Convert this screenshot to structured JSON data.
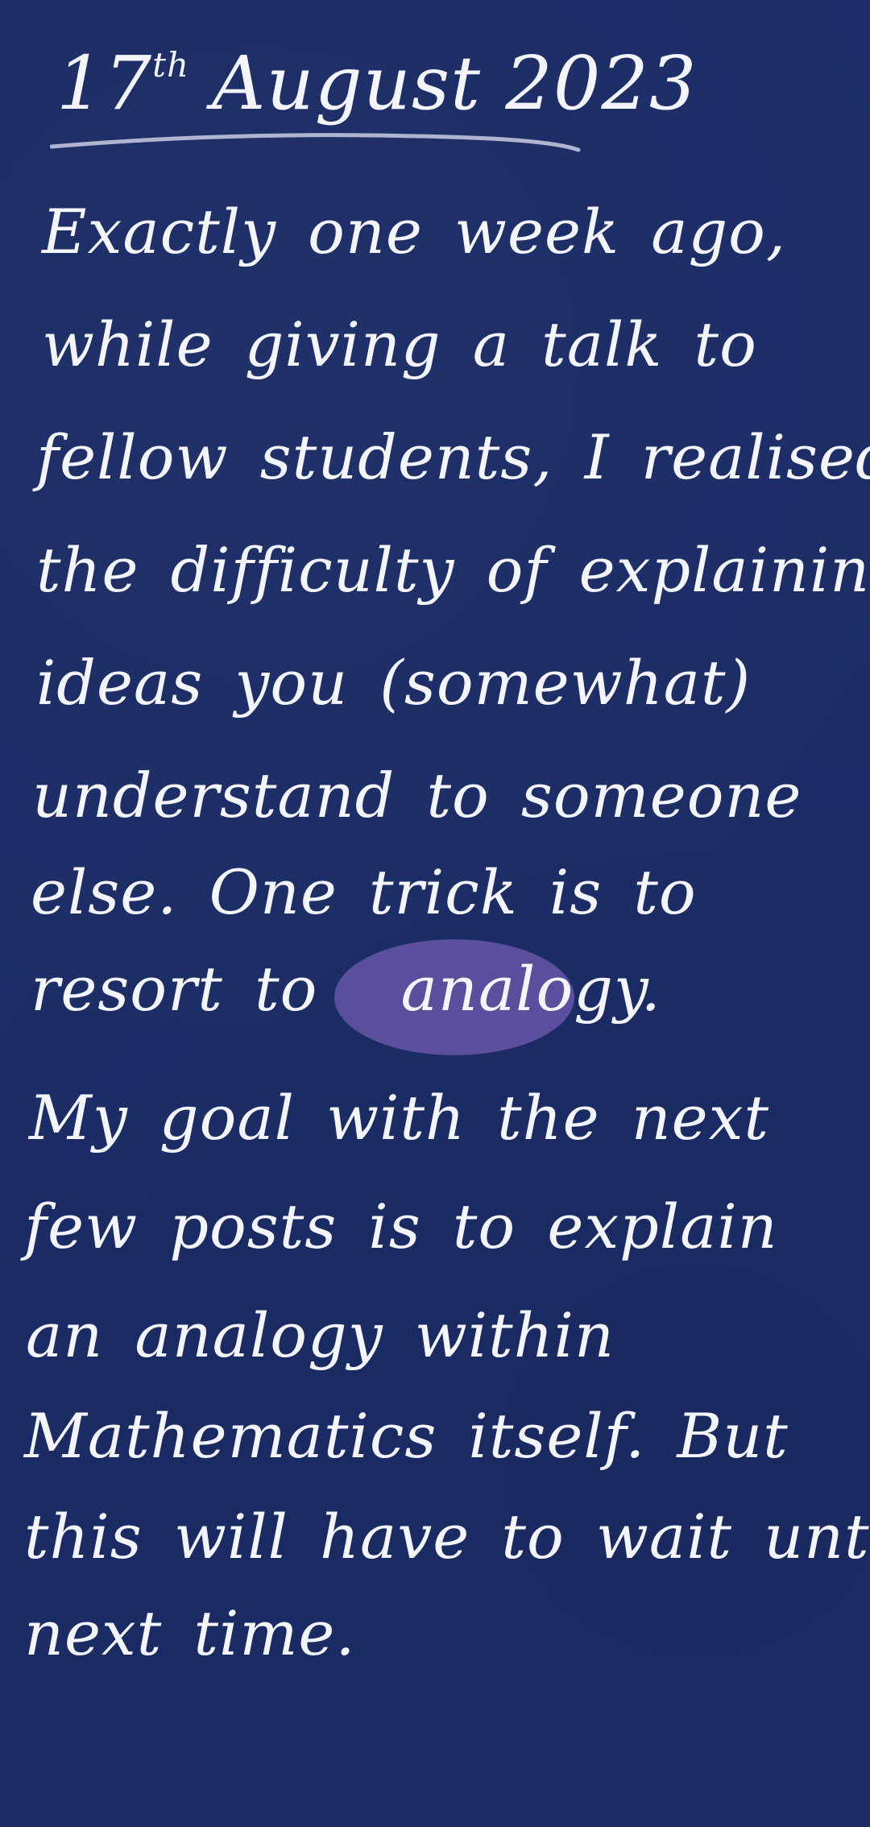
{
  "note": {
    "date": {
      "day": "17",
      "suffix": "th",
      "month_year": "August 2023"
    },
    "paragraph_1": {
      "lines": [
        "Exactly one week ago,",
        "while giving a talk to",
        "fellow students, I realised",
        "the difficulty of explaining",
        "ideas you (somewhat)",
        "understand to someone",
        "else. One trick is to"
      ],
      "last_line_lead": "resort to",
      "highlighted_word": "analogy."
    },
    "paragraph_2": {
      "lines": [
        "My goal with the next",
        "few posts is to explain",
        "an analogy within",
        "Mathematics itself. But",
        "this will have to wait until",
        "next time."
      ]
    }
  },
  "colors": {
    "background": "#1b2c66",
    "ink": "#f4f5fb",
    "highlight": "#5a4f9c"
  }
}
